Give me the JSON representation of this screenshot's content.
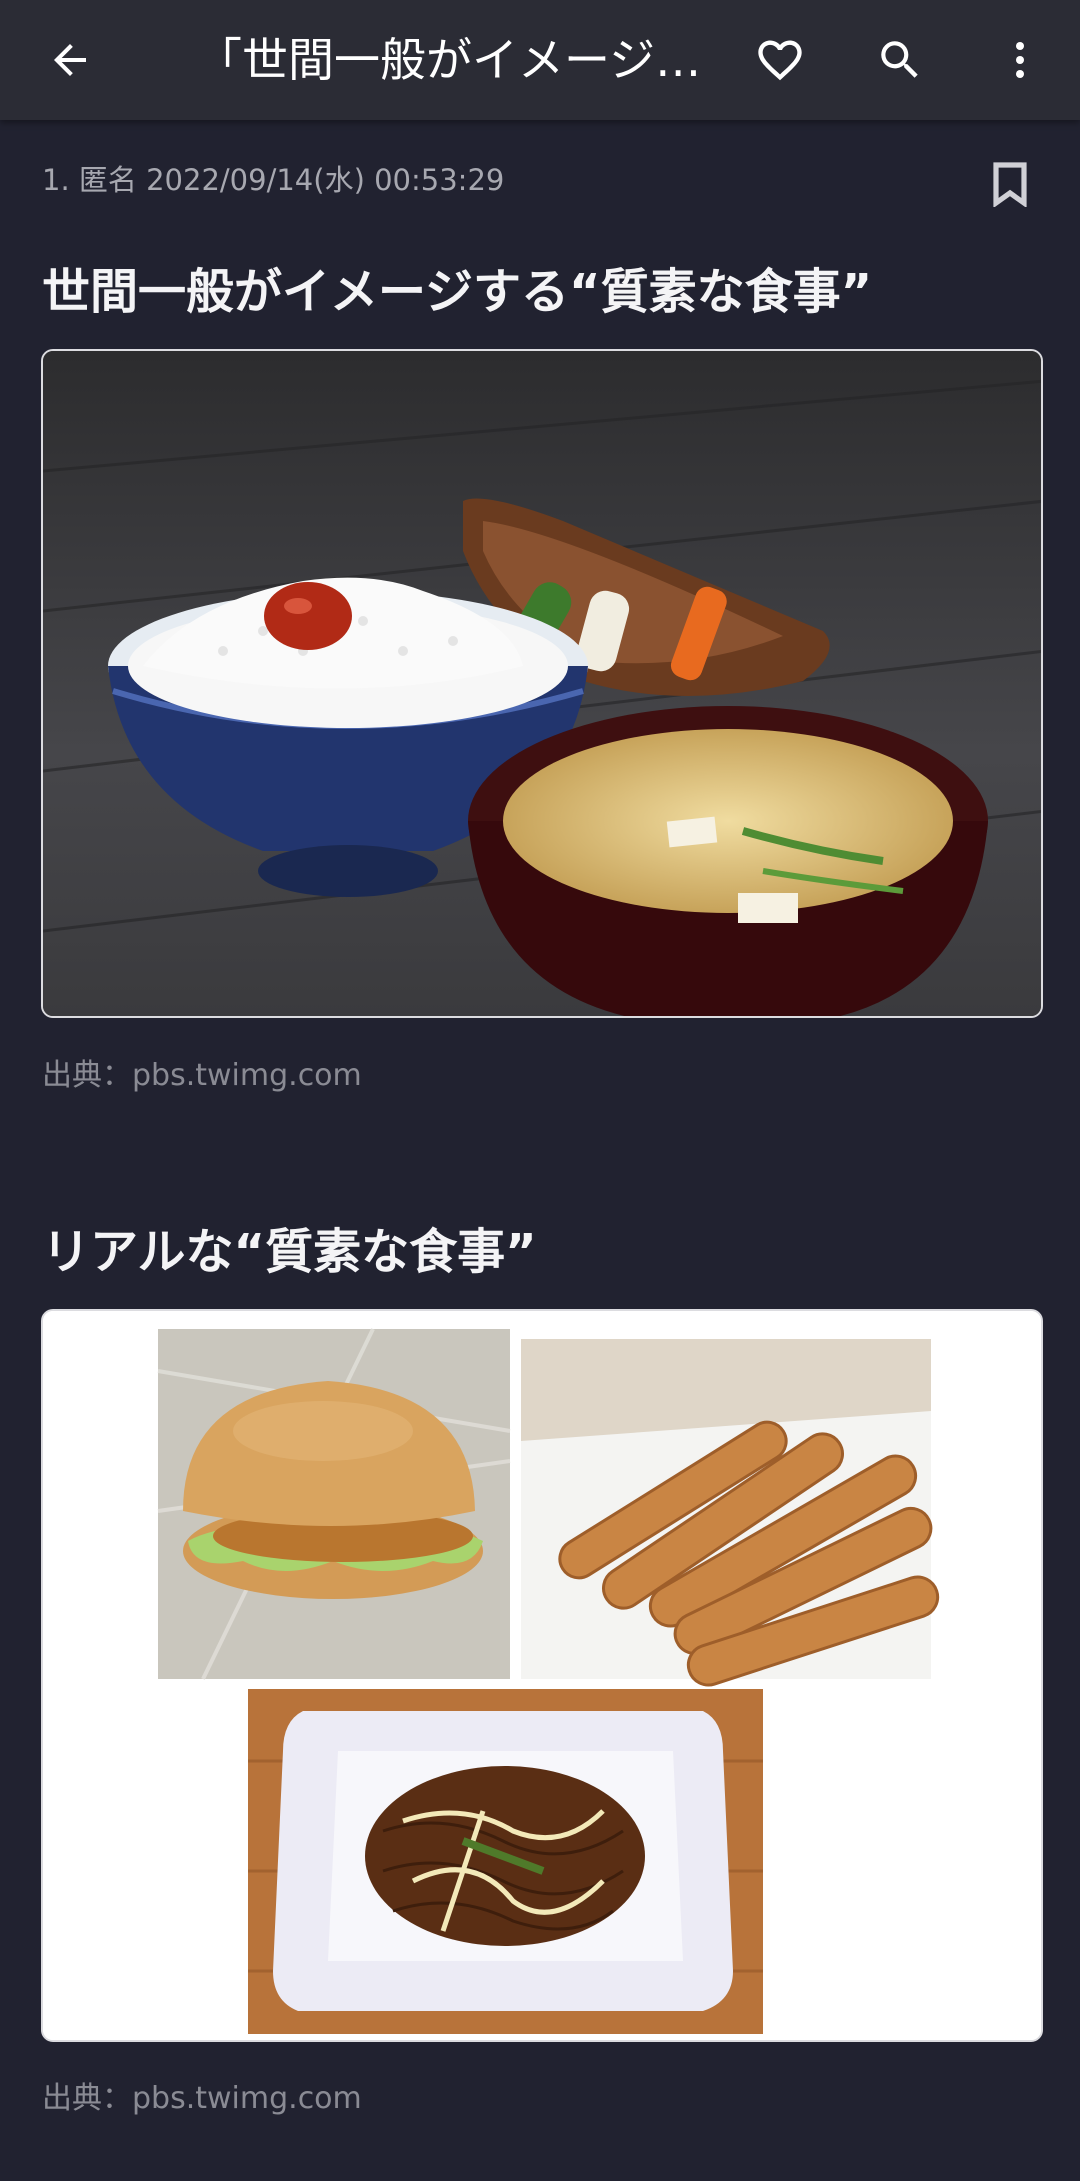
{
  "appbar": {
    "title": "「世間一般がイメージする“質素な食事”」",
    "back_icon": "arrow-back-icon",
    "favorite_icon": "heart-outline-icon",
    "search_icon": "search-icon",
    "menu_icon": "more-vert-icon"
  },
  "post": {
    "meta": "1. 匿名 2022/09/14(水) 00:53:29",
    "bookmark_icon": "bookmark-outline-icon",
    "heading1": "世間一般がイメージする“質素な食事”",
    "source1": "出典：pbs.twimg.com",
    "heading2": "リアルな“質素な食事”",
    "source2": "出典：pbs.twimg.com"
  },
  "colors": {
    "background": "#212230",
    "appbar": "#2b2c35",
    "meta_text": "#a7a8b0",
    "source_text": "#8a8b94"
  }
}
